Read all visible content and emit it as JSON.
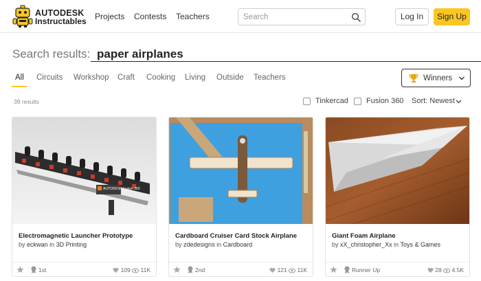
{
  "header": {
    "logo_line1": "AUTODESK",
    "logo_line2": "Instructables",
    "nav": [
      "Projects",
      "Contests",
      "Teachers"
    ],
    "search_placeholder": "Search",
    "login_label": "Log In",
    "signup_label": "Sign Up"
  },
  "search": {
    "label": "Search results:",
    "query": "paper airplanes"
  },
  "tabs": [
    "All",
    "Circuits",
    "Workshop",
    "Craft",
    "Cooking",
    "Living",
    "Outside",
    "Teachers"
  ],
  "active_tab": "All",
  "winners_label": "Winners",
  "results": {
    "count": "39 results",
    "filters": [
      "Tinkercad",
      "Fusion 360"
    ],
    "sort_label": "Sort: Newest"
  },
  "cards": [
    {
      "title": "Electromagnetic Launcher Prototype",
      "by": "by",
      "author": "eckwan",
      "in": "in",
      "category": "3D Printing",
      "award": "1st",
      "likes": "109",
      "views": "11K",
      "image_text": "AUTODESK Fusion 360"
    },
    {
      "title": "Cardboard Cruiser Card Stock Airplane",
      "by": "by",
      "author": "zdedesigns",
      "in": "in",
      "category": "Cardboard",
      "award": "2nd",
      "likes": "121",
      "views": "11K"
    },
    {
      "title": "Giant Foam Airplane",
      "by": "by",
      "author": "xX_christopher_Xx",
      "in": "in",
      "category": "Toys & Games",
      "award": "Runner Up",
      "likes": "28",
      "views": "4.5K"
    }
  ],
  "colors": {
    "accent": "#fac623",
    "text": "#333333",
    "border": "#e3e3e3"
  }
}
